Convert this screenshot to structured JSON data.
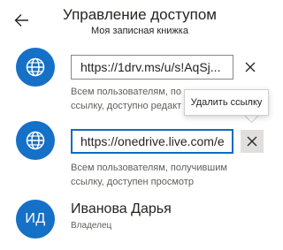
{
  "header": {
    "title": "Управление доступом",
    "subtitle": "Моя записная книжка"
  },
  "links": [
    {
      "url": "https://1drv.ms/u/s!AqSj...",
      "description_line1": "Всем пользователям, по",
      "description_line2": "ссылку, доступно редакт",
      "icon": "globe-icon"
    },
    {
      "url": "https://onedrive.live.com/e",
      "description_line1": "Всем пользователям, получившим",
      "description_line2": "ссылку, доступен просмотр",
      "icon": "globe-icon"
    }
  ],
  "tooltip": {
    "text": "Удалить ссылку"
  },
  "owner": {
    "initials": "ИД",
    "name": "Иванова Дарья",
    "role": "Владелец"
  },
  "colors": {
    "avatar": "#1570c7",
    "focus_border": "#0f6cbd"
  }
}
